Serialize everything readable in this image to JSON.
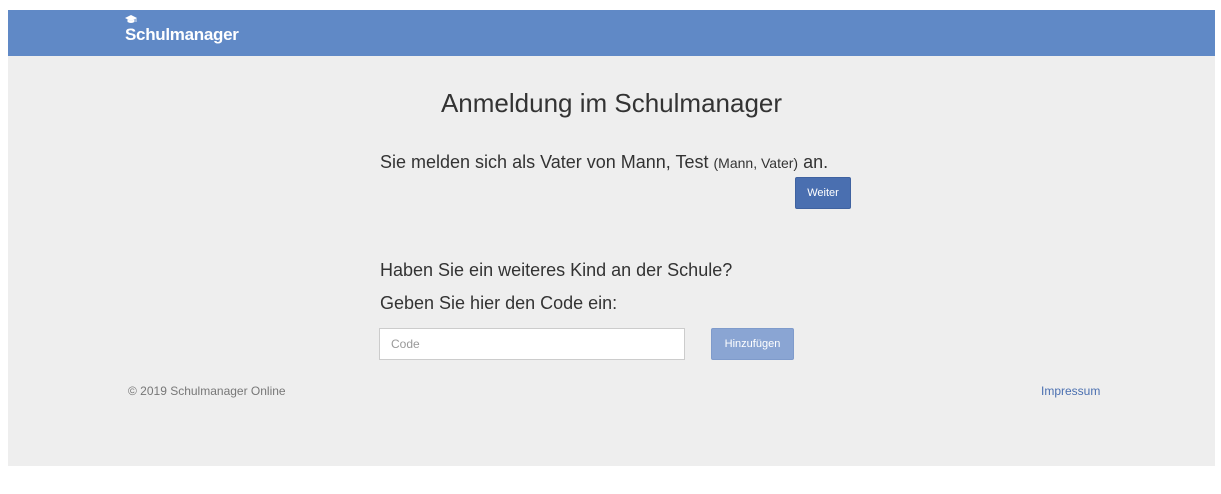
{
  "header": {
    "brand": "Schulmanager",
    "brand_icon": "graduation-cap-icon"
  },
  "main": {
    "title": "Anmeldung im Schulmanager",
    "login_prefix": "Sie melden sich als Vater von Mann, Test",
    "login_detail": "(Mann, Vater)",
    "login_suffix": "an.",
    "continue_button": "Weiter",
    "question": "Haben Sie ein weiteres Kind an der Schule?",
    "code_prompt": "Geben Sie hier den Code ein:",
    "code_input": {
      "placeholder": "Code",
      "value": ""
    },
    "add_button": "Hinzufügen"
  },
  "footer": {
    "copyright": "© 2019 Schulmanager Online",
    "impressum": "Impressum"
  },
  "colors": {
    "navbar": "#6089c6",
    "background": "#eeeeee",
    "primary_button": "#4a6fb0",
    "disabled_button": "#8aa5d3",
    "link": "#4a6fb0"
  }
}
